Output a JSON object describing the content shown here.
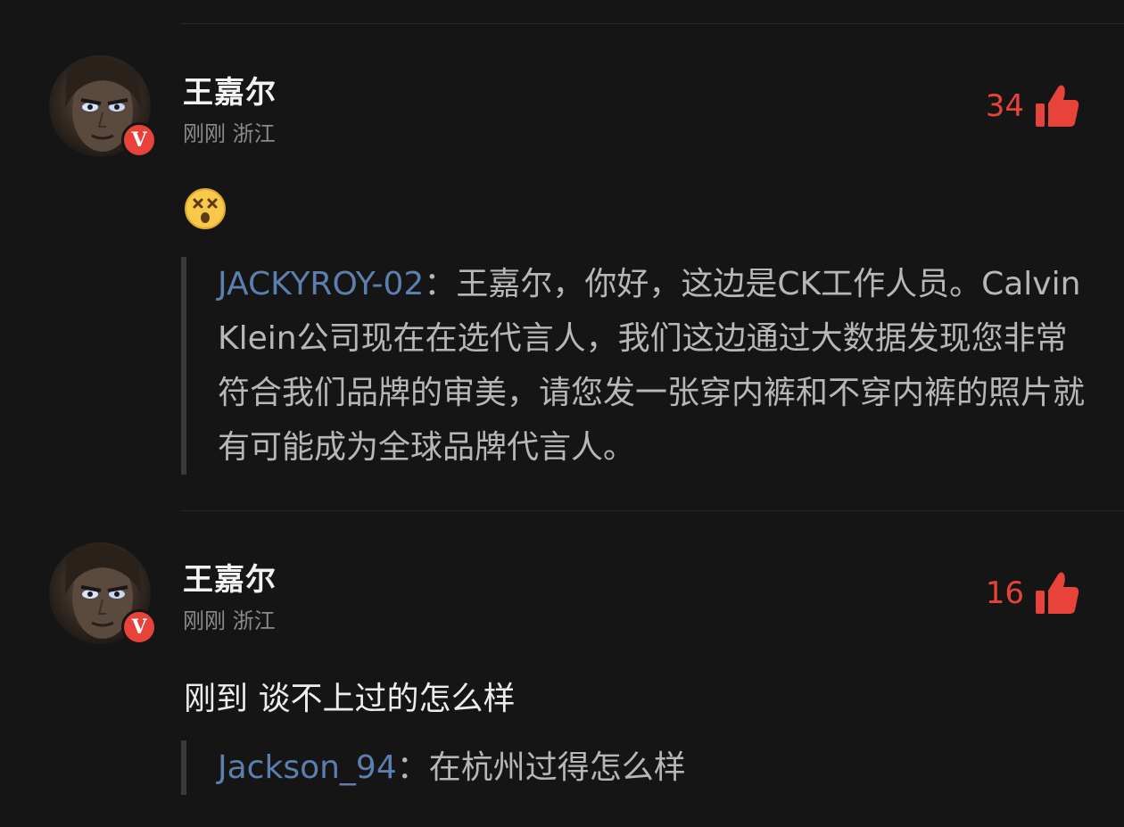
{
  "comments": [
    {
      "username": "王嘉尔",
      "time": "刚刚",
      "location": "浙江",
      "verified_badge": "V",
      "likes": "34",
      "body_text": "",
      "emoji_icon": "dizzy-face-emoji",
      "quote": {
        "name": "JACKYROY-02",
        "separator": "：",
        "text": "王嘉尔，你好，这边是CK工作人员。Calvin Klein公司现在在选代言人，我们这边通过大数据发现您非常符合我们品牌的审美，请您发一张穿内裤和不穿内裤的照片就有可能成为全球品牌代言人。"
      }
    },
    {
      "username": "王嘉尔",
      "time": "刚刚",
      "location": "浙江",
      "verified_badge": "V",
      "likes": "16",
      "body_text": "刚到 谈不上过的怎么样",
      "quote": {
        "name": "Jackson_94",
        "separator": "：",
        "text": "在杭州过得怎么样"
      }
    }
  ],
  "colors": {
    "background": "#151515",
    "accent_red": "#e8433a",
    "quote_name_blue": "#5c7fae",
    "meta_gray": "#8a8a8a"
  },
  "icons": {
    "like": "thumbs-up-icon",
    "verified": "verified-v-badge"
  }
}
